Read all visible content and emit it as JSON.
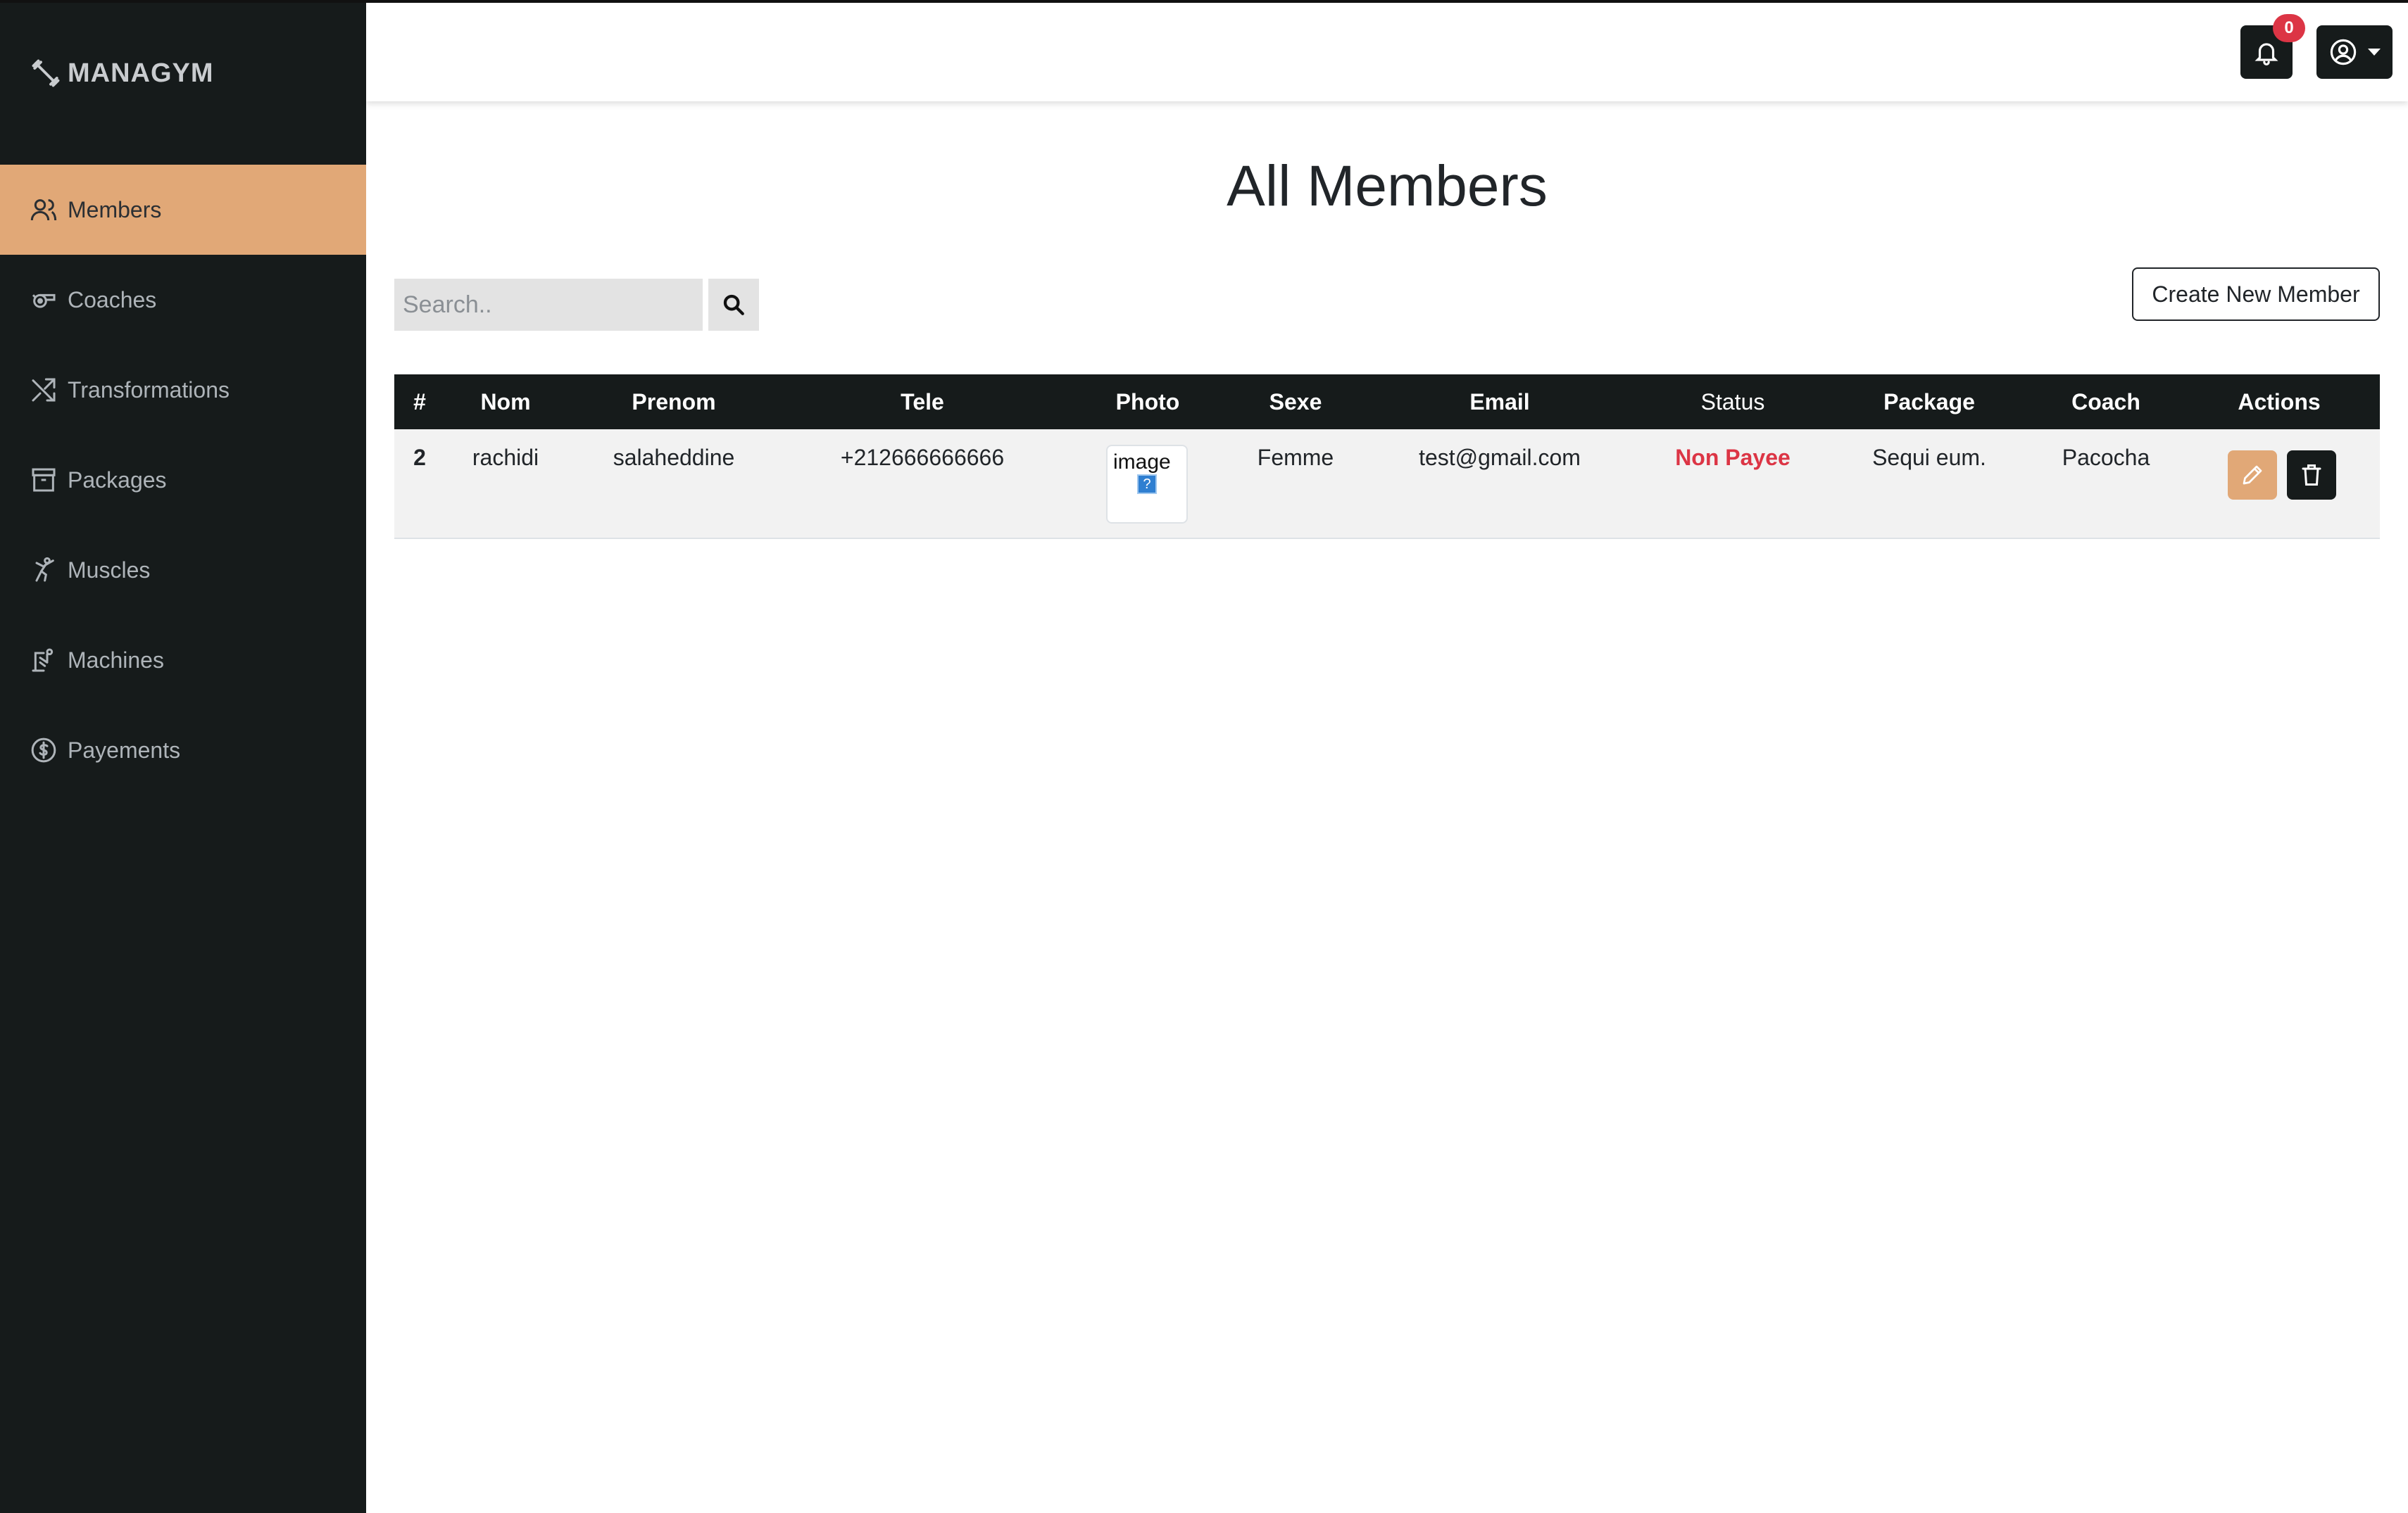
{
  "brand": {
    "name": "MANAGYM"
  },
  "sidebar": {
    "items": [
      {
        "label": "Members",
        "icon": "people-icon",
        "active": true
      },
      {
        "label": "Coaches",
        "icon": "whistle-icon",
        "active": false
      },
      {
        "label": "Transformations",
        "icon": "shuffle-icon",
        "active": false
      },
      {
        "label": "Packages",
        "icon": "archive-icon",
        "active": false
      },
      {
        "label": "Muscles",
        "icon": "martial-arts-icon",
        "active": false
      },
      {
        "label": "Machines",
        "icon": "workout-machine-icon",
        "active": false
      },
      {
        "label": "Payements",
        "icon": "dollar-circle-icon",
        "active": false
      }
    ]
  },
  "header": {
    "notification_count": "0"
  },
  "main": {
    "title": "All Members",
    "search_placeholder": "Search..",
    "create_button": "Create New Member"
  },
  "table": {
    "headers": [
      "#",
      "Nom",
      "Prenom",
      "Tele",
      "Photo",
      "Sexe",
      "Email",
      "Status",
      "Package",
      "Coach",
      "Actions"
    ],
    "rows": [
      {
        "id": "2",
        "nom": "rachidi",
        "prenom": "salaheddine",
        "tele": "+212666666666",
        "photo_alt": "image",
        "sexe": "Femme",
        "email": "test@gmail.com",
        "status": "Non Payee",
        "package": "Sequi eum.",
        "coach": "Pacocha"
      }
    ]
  },
  "colors": {
    "sidebar_bg": "#161b1b",
    "accent": "#e1a877",
    "status_unpaid": "#dc3545",
    "badge": "#dc3545"
  }
}
